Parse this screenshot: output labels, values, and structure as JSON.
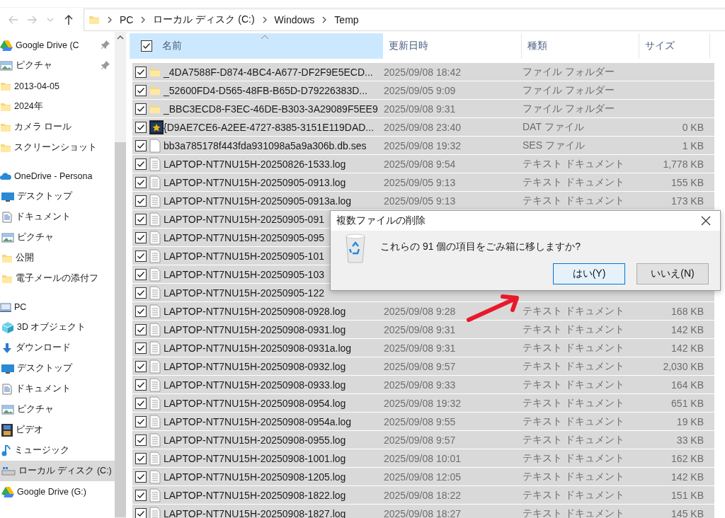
{
  "nav": {
    "buttons": [
      {
        "kind": "back",
        "disabled": true
      },
      {
        "kind": "forward",
        "disabled": true
      },
      {
        "kind": "recent",
        "disabled": true
      },
      {
        "kind": "up",
        "disabled": false
      }
    ],
    "breadcrumb": [
      "PC",
      "ローカル ディスク (C:)",
      "Windows",
      "Temp"
    ]
  },
  "sidebar": {
    "items": [
      {
        "label": "Google Drive (C",
        "kind": "gdrive",
        "pinned": true,
        "selected": false
      },
      {
        "label": "ピクチャ",
        "kind": "picture",
        "pinned": true,
        "selected": false
      },
      {
        "label": "2013-04-05",
        "kind": "folder",
        "pinned": false,
        "selected": false
      },
      {
        "label": "2024年",
        "kind": "folder",
        "pinned": false,
        "selected": false
      },
      {
        "label": "カメラ ロール",
        "kind": "folder",
        "pinned": false,
        "selected": false
      },
      {
        "label": "スクリーンショット",
        "kind": "folder",
        "pinned": false,
        "selected": false
      },
      {
        "label": "OneDrive - Persona",
        "kind": "cloud",
        "pinned": false,
        "selected": false,
        "children": [
          {
            "label": "デスクトップ",
            "kind": "desktop",
            "selected": false
          },
          {
            "label": "ドキュメント",
            "kind": "document",
            "selected": false
          },
          {
            "label": "ピクチャ",
            "kind": "picture",
            "selected": false
          },
          {
            "label": "公開",
            "kind": "folder",
            "selected": false
          },
          {
            "label": "電子メールの添付フ",
            "kind": "folder",
            "selected": false
          }
        ]
      },
      {
        "label": "PC",
        "kind": "pc",
        "pinned": false,
        "selected": false,
        "children": [
          {
            "label": "3D オブジェクト",
            "kind": "cube",
            "selected": false
          },
          {
            "label": "ダウンロード",
            "kind": "download",
            "selected": false
          },
          {
            "label": "デスクトップ",
            "kind": "desktop",
            "selected": false
          },
          {
            "label": "ドキュメント",
            "kind": "document",
            "selected": false
          },
          {
            "label": "ピクチャ",
            "kind": "picture",
            "selected": false
          },
          {
            "label": "ビデオ",
            "kind": "video",
            "selected": false
          },
          {
            "label": "ミュージック",
            "kind": "music",
            "selected": false
          },
          {
            "label": "ローカル ディスク (C:)",
            "kind": "disk",
            "selected": true
          },
          {
            "label": "Google Drive (G:)",
            "kind": "gdrive",
            "selected": false
          }
        ]
      }
    ]
  },
  "table": {
    "select_all": {
      "checked": true
    },
    "columns": [
      {
        "label": "名前",
        "kind": "name",
        "highlighted": true,
        "sorted": true
      },
      {
        "label": "更新日時",
        "kind": "date",
        "highlighted": false,
        "sorted": false
      },
      {
        "label": "種類",
        "kind": "type",
        "highlighted": false,
        "sorted": false
      },
      {
        "label": "サイズ",
        "kind": "size",
        "highlighted": false,
        "sorted": false
      }
    ],
    "rows": [
      {
        "name": "_4DA7588F-D874-4BC4-A677-DF2F9E5ECD...",
        "date": "2025/09/08 18:42",
        "type": "ファイル フォルダー",
        "kind": "folder",
        "selected": true
      },
      {
        "name": "_52600FD4-D565-48FB-B65D-D79226383D...",
        "date": "2025/09/05 9:09",
        "type": "ファイル フォルダー",
        "kind": "folder",
        "selected": true
      },
      {
        "name": "_BBC3ECD8-F3EC-46DE-B303-3A29089F5EE9",
        "date": "2025/09/08 9:31",
        "type": "ファイル フォルダー",
        "kind": "folder",
        "selected": true
      },
      {
        "name": "{D9AE7CE6-A2EE-4727-8385-3151E119DAD...",
        "date": "2025/09/08 23:40",
        "type": "DAT ファイル",
        "size": "0 KB",
        "kind": "media",
        "selected": true
      },
      {
        "name": "bb3a785178f443fda931098a5a9a306b.db.ses",
        "date": "2025/09/08 19:32",
        "type": "SES ファイル",
        "size": "1 KB",
        "kind": "blank",
        "selected": true
      },
      {
        "name": "LAPTOP-NT7NU15H-20250826-1533.log",
        "date": "2025/09/08 9:54",
        "type": "テキスト ドキュメント",
        "size": "1,778 KB",
        "kind": "text",
        "selected": true
      },
      {
        "name": "LAPTOP-NT7NU15H-20250905-0913.log",
        "date": "2025/09/05 9:13",
        "type": "テキスト ドキュメント",
        "size": "155 KB",
        "kind": "text",
        "selected": true
      },
      {
        "name": "LAPTOP-NT7NU15H-20250905-0913a.log",
        "date": "2025/09/05 9:13",
        "type": "テキスト ドキュメント",
        "size": "173 KB",
        "kind": "text",
        "selected": true
      },
      {
        "name": "LAPTOP-NT7NU15H-20250905-091",
        "kind": "text",
        "selected": true
      },
      {
        "name": "LAPTOP-NT7NU15H-20250905-095",
        "kind": "text",
        "selected": true
      },
      {
        "name": "LAPTOP-NT7NU15H-20250905-101",
        "kind": "text",
        "selected": true
      },
      {
        "name": "LAPTOP-NT7NU15H-20250905-103",
        "kind": "text",
        "selected": true
      },
      {
        "name": "LAPTOP-NT7NU15H-20250905-122",
        "kind": "text",
        "selected": true
      },
      {
        "name": "LAPTOP-NT7NU15H-20250908-0928.log",
        "date": "2025/09/08 9:28",
        "type": "テキスト ドキュメント",
        "size": "168 KB",
        "kind": "text",
        "selected": true
      },
      {
        "name": "LAPTOP-NT7NU15H-20250908-0931.log",
        "date": "2025/09/08 9:31",
        "type": "テキスト ドキュメント",
        "size": "142 KB",
        "kind": "text",
        "selected": true
      },
      {
        "name": "LAPTOP-NT7NU15H-20250908-0931a.log",
        "date": "2025/09/08 9:31",
        "type": "テキスト ドキュメント",
        "size": "142 KB",
        "kind": "text",
        "selected": true
      },
      {
        "name": "LAPTOP-NT7NU15H-20250908-0932.log",
        "date": "2025/09/08 9:57",
        "type": "テキスト ドキュメント",
        "size": "2,030 KB",
        "kind": "text",
        "selected": true
      },
      {
        "name": "LAPTOP-NT7NU15H-20250908-0933.log",
        "date": "2025/09/08 9:33",
        "type": "テキスト ドキュメント",
        "size": "164 KB",
        "kind": "text",
        "selected": true
      },
      {
        "name": "LAPTOP-NT7NU15H-20250908-0954.log",
        "date": "2025/09/08 19:32",
        "type": "テキスト ドキュメント",
        "size": "651 KB",
        "kind": "text",
        "selected": true
      },
      {
        "name": "LAPTOP-NT7NU15H-20250908-0954a.log",
        "date": "2025/09/08 9:55",
        "type": "テキスト ドキュメント",
        "size": "19 KB",
        "kind": "text",
        "selected": true
      },
      {
        "name": "LAPTOP-NT7NU15H-20250908-0955.log",
        "date": "2025/09/08 9:57",
        "type": "テキスト ドキュメント",
        "size": "33 KB",
        "kind": "text",
        "selected": true
      },
      {
        "name": "LAPTOP-NT7NU15H-20250908-1001.log",
        "date": "2025/09/08 10:01",
        "type": "テキスト ドキュメント",
        "size": "162 KB",
        "kind": "text",
        "selected": true
      },
      {
        "name": "LAPTOP-NT7NU15H-20250908-1205.log",
        "date": "2025/09/08 12:05",
        "type": "テキスト ドキュメント",
        "size": "142 KB",
        "kind": "text",
        "selected": true
      },
      {
        "name": "LAPTOP-NT7NU15H-20250908-1822.log",
        "date": "2025/09/08 18:22",
        "type": "テキスト ドキュメント",
        "size": "151 KB",
        "kind": "text",
        "selected": true
      },
      {
        "name": "LAPTOP-NT7NU15H-20250908-1827.log",
        "date": "2025/09/08 18:27",
        "type": "テキスト ドキュメント",
        "size": "145 KB",
        "kind": "text",
        "selected": true
      }
    ]
  },
  "dialog": {
    "title": "複数ファイルの削除",
    "message": "これらの 91 個の項目をごみ箱に移しますか?",
    "buttons": [
      {
        "label": "はい(Y)",
        "default": true
      },
      {
        "label": "いいえ(N)",
        "default": false
      }
    ]
  }
}
